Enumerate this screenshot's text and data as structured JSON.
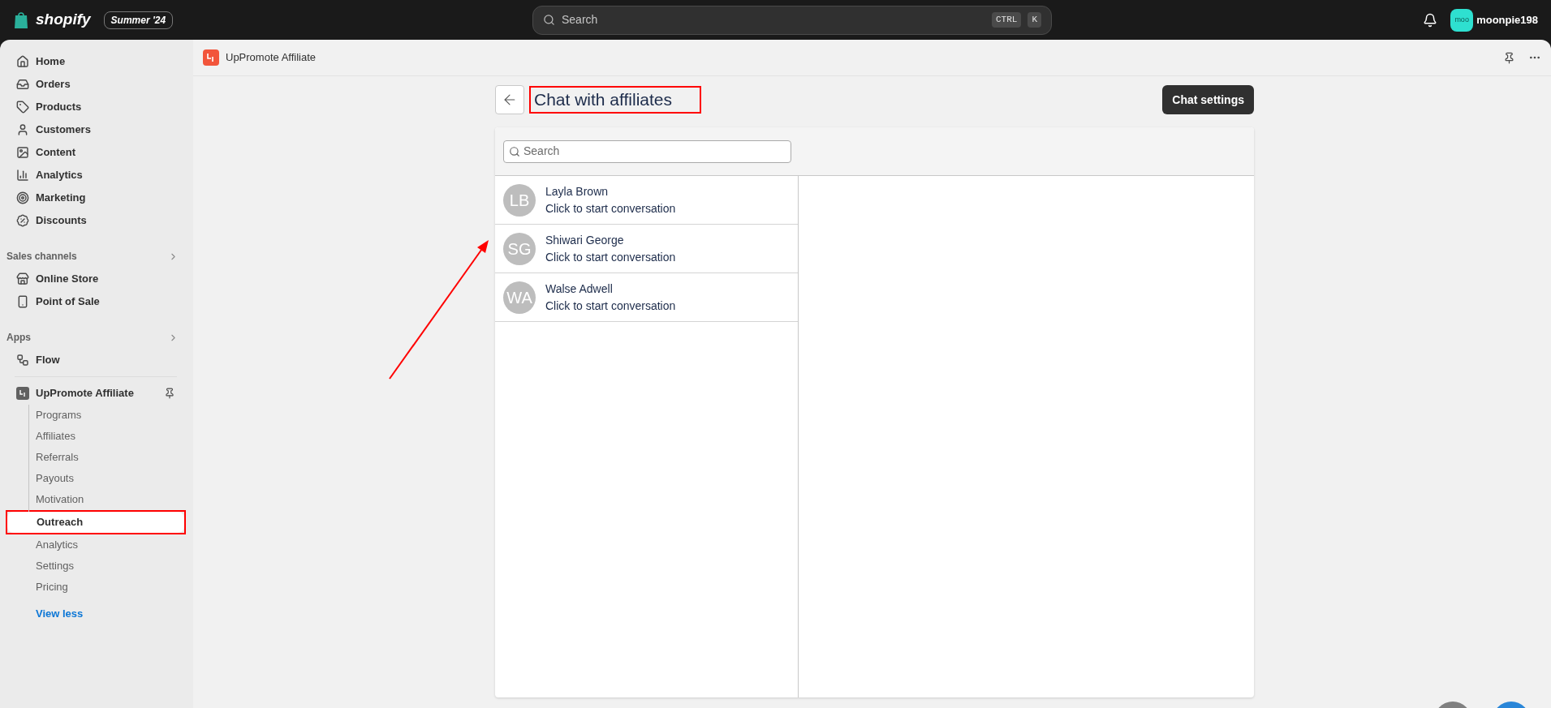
{
  "topbar": {
    "brand": "shopify",
    "edition": "Summer '24",
    "search": {
      "placeholder": "Search",
      "keys": [
        "CTRL",
        "K"
      ]
    },
    "avatar_text": "moo",
    "store": "moonpie198"
  },
  "sidebar": {
    "items": [
      {
        "label": "Home",
        "kind": "home"
      },
      {
        "label": "Orders",
        "kind": "inbox"
      },
      {
        "label": "Products",
        "kind": "tag"
      },
      {
        "label": "Customers",
        "kind": "person"
      },
      {
        "label": "Content",
        "kind": "image"
      },
      {
        "label": "Analytics",
        "kind": "chart"
      },
      {
        "label": "Marketing",
        "kind": "target"
      },
      {
        "label": "Discounts",
        "kind": "badge"
      }
    ],
    "sections": [
      {
        "title": "Sales channels",
        "items": [
          {
            "label": "Online Store",
            "kind": "store"
          },
          {
            "label": "Point of Sale",
            "kind": "pos"
          }
        ]
      },
      {
        "title": "Apps",
        "items": [
          {
            "label": "Flow",
            "kind": "flow"
          }
        ]
      }
    ],
    "app": {
      "label": "UpPromote Affiliate",
      "children": [
        {
          "label": "Programs",
          "selected": false
        },
        {
          "label": "Affiliates",
          "selected": false
        },
        {
          "label": "Referrals",
          "selected": false
        },
        {
          "label": "Payouts",
          "selected": false
        },
        {
          "label": "Motivation",
          "selected": false
        },
        {
          "label": "Outreach",
          "selected": true
        },
        {
          "label": "Analytics",
          "selected": false
        },
        {
          "label": "Settings",
          "selected": false
        },
        {
          "label": "Pricing",
          "selected": false
        }
      ]
    },
    "view_less": "View less"
  },
  "app_header": {
    "title": "UpPromote Affiliate"
  },
  "page": {
    "title": "Chat with affiliates",
    "action": "Chat settings",
    "search": {
      "placeholder": "Search"
    },
    "contacts": [
      {
        "initials": "LB",
        "name": "Layla Brown",
        "subtitle": "Click to start conversation"
      },
      {
        "initials": "SG",
        "name": "Shiwari George",
        "subtitle": "Click to start conversation"
      },
      {
        "initials": "WA",
        "name": "Walse Adwell",
        "subtitle": "Click to start conversation"
      }
    ]
  }
}
